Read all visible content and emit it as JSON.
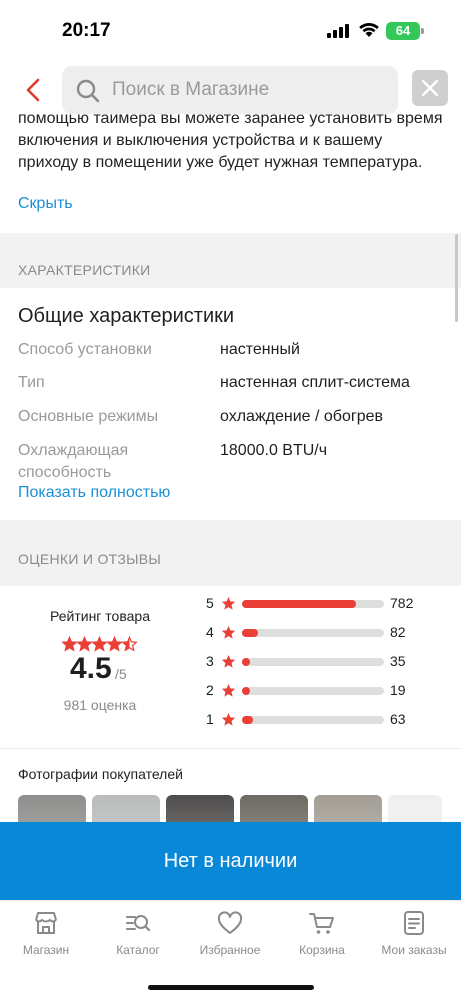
{
  "status_bar": {
    "time": "20:17",
    "battery": "64"
  },
  "header": {
    "search_placeholder": "Поиск в Магазине"
  },
  "description": {
    "text": "помощью таймера вы можете заранее установить время включения и выключения устройства и к вашему приходу в помещении уже будет нужная температура.",
    "hide_label": "Скрыть"
  },
  "characteristics": {
    "section_title": "ХАРАКТЕРИСТИКИ",
    "group_title": "Общие характеристики",
    "rows": [
      {
        "label": "Способ установки",
        "value": "настенный"
      },
      {
        "label": "Тип",
        "value": "настенная сплит-система"
      },
      {
        "label": "Основные режимы",
        "value": "охлаждение / обогрев"
      },
      {
        "label": "Охлаждающая способность",
        "value": "18000.0 BTU/ч"
      }
    ],
    "show_all_label": "Показать полностью"
  },
  "reviews": {
    "section_title": "ОЦЕНКИ И ОТЗЫВЫ",
    "rating_caption": "Рейтинг товара",
    "rating_value": "4.5",
    "rating_max": "/5",
    "rating_count": "981 оценка",
    "star_rating": 4.5,
    "distribution": [
      {
        "stars": "5",
        "count": "782",
        "fraction": 0.8
      },
      {
        "stars": "4",
        "count": "82",
        "fraction": 0.11
      },
      {
        "stars": "3",
        "count": "35",
        "fraction": 0.05
      },
      {
        "stars": "2",
        "count": "19",
        "fraction": 0.03
      },
      {
        "stars": "1",
        "count": "63",
        "fraction": 0.08
      }
    ],
    "accent_color": "#ea3f36"
  },
  "photos": {
    "title": "Фотографии покупателей",
    "thumb_colors": [
      "#8e8e8c",
      "#b9bcbb",
      "#4f4d4c",
      "#6d6a63",
      "#a39e94",
      "#efefef"
    ]
  },
  "action": {
    "unavailable_label": "Нет в наличии",
    "color": "#0a88d8"
  },
  "tab_bar": {
    "tabs": [
      {
        "label": "Магазин",
        "icon": "store-icon"
      },
      {
        "label": "Каталог",
        "icon": "catalog-icon"
      },
      {
        "label": "Избранное",
        "icon": "heart-icon"
      },
      {
        "label": "Корзина",
        "icon": "cart-icon"
      },
      {
        "label": "Мои заказы",
        "icon": "orders-icon"
      }
    ]
  }
}
